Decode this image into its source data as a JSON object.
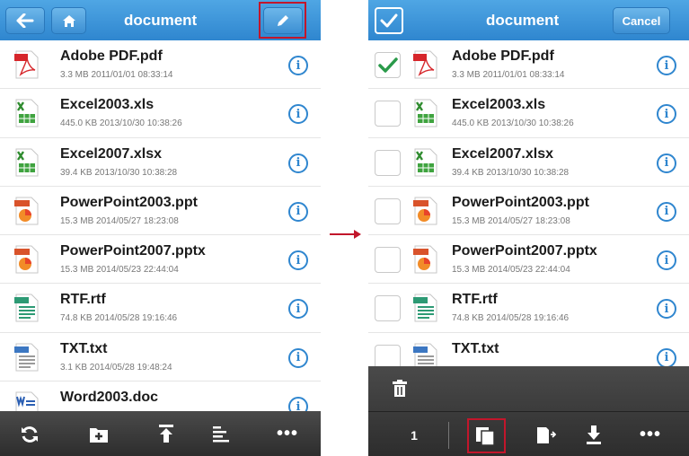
{
  "left_panel": {
    "header": {
      "title": "document",
      "back_icon": "arrow-left-icon",
      "home_icon": "home-icon",
      "edit_icon": "pencil-icon"
    },
    "files": [
      {
        "name": "Adobe PDF.pdf",
        "meta": "3.3 MB 2011/01/01 08:33:14",
        "type": "pdf"
      },
      {
        "name": "Excel2003.xls",
        "meta": "445.0 KB 2013/10/30 10:38:26",
        "type": "excel"
      },
      {
        "name": "Excel2007.xlsx",
        "meta": "39.4 KB 2013/10/30 10:38:28",
        "type": "excel"
      },
      {
        "name": "PowerPoint2003.ppt",
        "meta": "15.3 MB 2014/05/27 18:23:08",
        "type": "ppt"
      },
      {
        "name": "PowerPoint2007.pptx",
        "meta": "15.3 MB 2014/05/23 22:44:04",
        "type": "ppt"
      },
      {
        "name": "RTF.rtf",
        "meta": "74.8 KB 2014/05/28 19:16:46",
        "type": "rtf"
      },
      {
        "name": "TXT.txt",
        "meta": "3.1 KB 2014/05/28 19:48:24",
        "type": "txt"
      },
      {
        "name": "Word2003.doc",
        "meta": "",
        "type": "word"
      }
    ],
    "toolbar_icons": [
      "refresh-icon",
      "new-folder-icon",
      "upload-icon",
      "sort-icon",
      "more-icon"
    ],
    "more_label": "•••"
  },
  "right_panel": {
    "header": {
      "title": "document",
      "cancel_label": "Cancel",
      "select_all_icon": "checkbox-checked-icon"
    },
    "files": [
      {
        "name": "Adobe PDF.pdf",
        "meta": "3.3 MB 2011/01/01 08:33:14",
        "type": "pdf",
        "checked": true
      },
      {
        "name": "Excel2003.xls",
        "meta": "445.0 KB 2013/10/30 10:38:26",
        "type": "excel",
        "checked": false
      },
      {
        "name": "Excel2007.xlsx",
        "meta": "39.4 KB 2013/10/30 10:38:28",
        "type": "excel",
        "checked": false
      },
      {
        "name": "PowerPoint2003.ppt",
        "meta": "15.3 MB 2014/05/27 18:23:08",
        "type": "ppt",
        "checked": false
      },
      {
        "name": "PowerPoint2007.pptx",
        "meta": "15.3 MB 2014/05/23 22:44:04",
        "type": "ppt",
        "checked": false
      },
      {
        "name": "RTF.rtf",
        "meta": "74.8 KB 2014/05/28 19:16:46",
        "type": "rtf",
        "checked": false
      },
      {
        "name": "TXT.txt",
        "meta": "",
        "type": "txt",
        "checked": false
      }
    ],
    "selected_count": "1",
    "toolbar_icons": [
      "trash-icon",
      "copy-icon",
      "move-icon",
      "download-icon",
      "more-icon"
    ],
    "more_label": "•••"
  },
  "colors": {
    "accent": "#2f86cf",
    "highlight": "#c2162b",
    "toolbar": "#333333"
  }
}
